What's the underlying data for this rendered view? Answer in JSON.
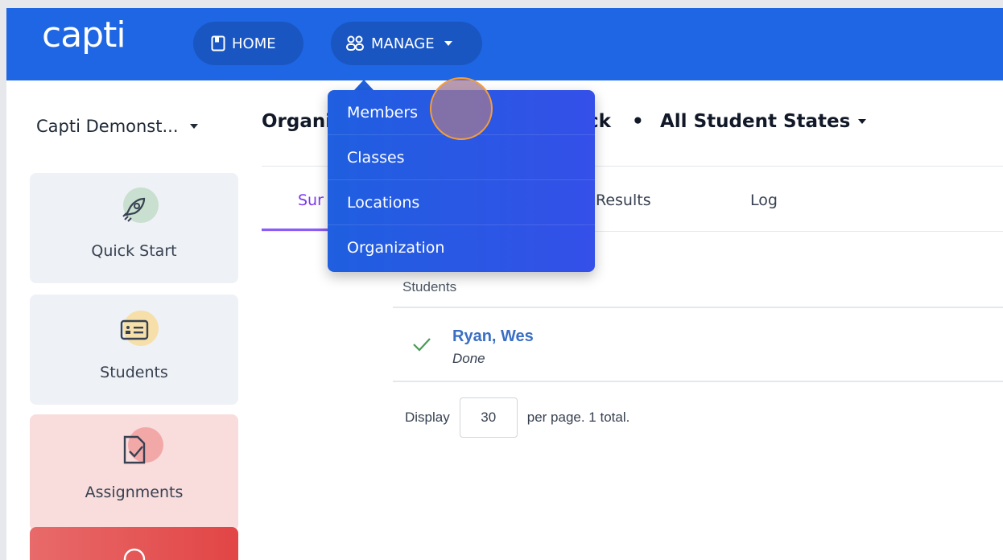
{
  "header": {
    "logo": "capti",
    "home_label": "HOME",
    "manage_label": "MANAGE",
    "brand_color": "#1e66e3"
  },
  "sidebar": {
    "org_name": "Capti Demonst...",
    "cards": [
      {
        "label": "Quick Start",
        "icon": "rocket-icon"
      },
      {
        "label": "Students",
        "icon": "id-card-icon"
      },
      {
        "label": "Assignments",
        "icon": "assignment-icon"
      }
    ]
  },
  "breadcrumb": {
    "part1": "Organi",
    "part2": "ck",
    "separator": "•",
    "state": "All Student States"
  },
  "tabs": {
    "summary_partial": "Sur",
    "results": "Results",
    "log": "Log"
  },
  "table": {
    "column_header": "Students",
    "rows": [
      {
        "name": "Ryan, Wes",
        "status": "Done"
      }
    ]
  },
  "pager": {
    "prefix": "Display",
    "page_size": "30",
    "suffix": "per page. 1 total."
  },
  "manage_menu": {
    "items": [
      "Members",
      "Classes",
      "Locations",
      "Organization"
    ]
  }
}
